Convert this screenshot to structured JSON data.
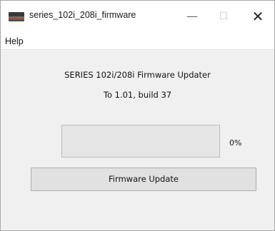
{
  "window": {
    "title": "series_102i_208i_firmware",
    "min_glyph": "—",
    "max_glyph": "☐",
    "close_glyph": "✕"
  },
  "menu": {
    "items": [
      "Help"
    ]
  },
  "content": {
    "title": "SERIES 102i/208i Firmware Updater",
    "version": "To 1.01, build 37",
    "progress_percent_label": "0%",
    "progress_fraction": 0,
    "button_label": "Firmware Update"
  },
  "colors": {
    "progress_fill": "#06b025",
    "window_bg": "#f0f0f0"
  },
  "icons": {
    "app": "printer-app-icon"
  }
}
